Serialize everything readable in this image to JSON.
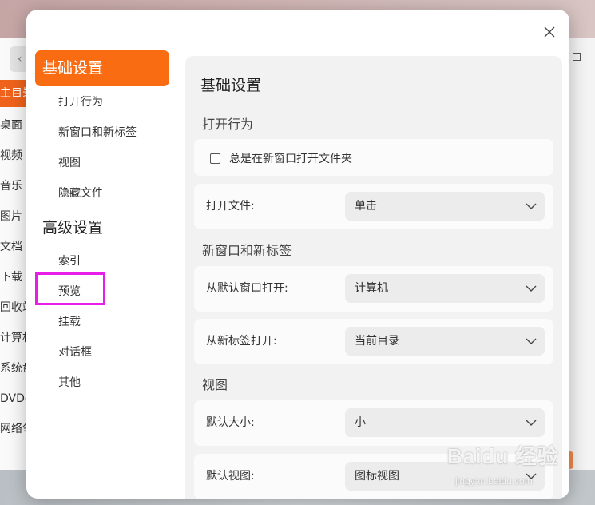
{
  "background": {
    "nav_items": [
      "主目录",
      "桌面",
      "视频",
      "音乐",
      "图片",
      "文档",
      "下载",
      "回收站",
      "计算机",
      "系统盘",
      "DVD-R",
      "网络邻居"
    ]
  },
  "dialog": {
    "close_icon": "close-icon",
    "nav": {
      "groups": [
        {
          "title": "基础设置",
          "items": [
            "打开行为",
            "新窗口和新标签",
            "视图",
            "隐藏文件"
          ]
        },
        {
          "title": "高级设置",
          "items": [
            "索引",
            "预览",
            "挂载",
            "对话框",
            "其他"
          ]
        }
      ]
    },
    "content": {
      "title": "基础设置",
      "sections": {
        "open_behavior": {
          "title": "打开行为",
          "checkbox_label": "总是在新窗口打开文件夹",
          "checkbox_checked": false,
          "open_file_label": "打开文件:",
          "open_file_value": "单击"
        },
        "new_window": {
          "title": "新窗口和新标签",
          "default_window_label": "从默认窗口打开:",
          "default_window_value": "计算机",
          "new_tab_label": "从新标签打开:",
          "new_tab_value": "当前目录"
        },
        "view": {
          "title": "视图",
          "default_size_label": "默认大小:",
          "default_size_value": "小",
          "default_view_label": "默认视图:",
          "default_view_value": "图标视图"
        }
      }
    }
  },
  "watermark": {
    "main": "Baidu 经验",
    "sub": "jingyan.baidu.com"
  },
  "colors": {
    "accent": "#fa6c12",
    "highlight": "#e81ee8"
  }
}
